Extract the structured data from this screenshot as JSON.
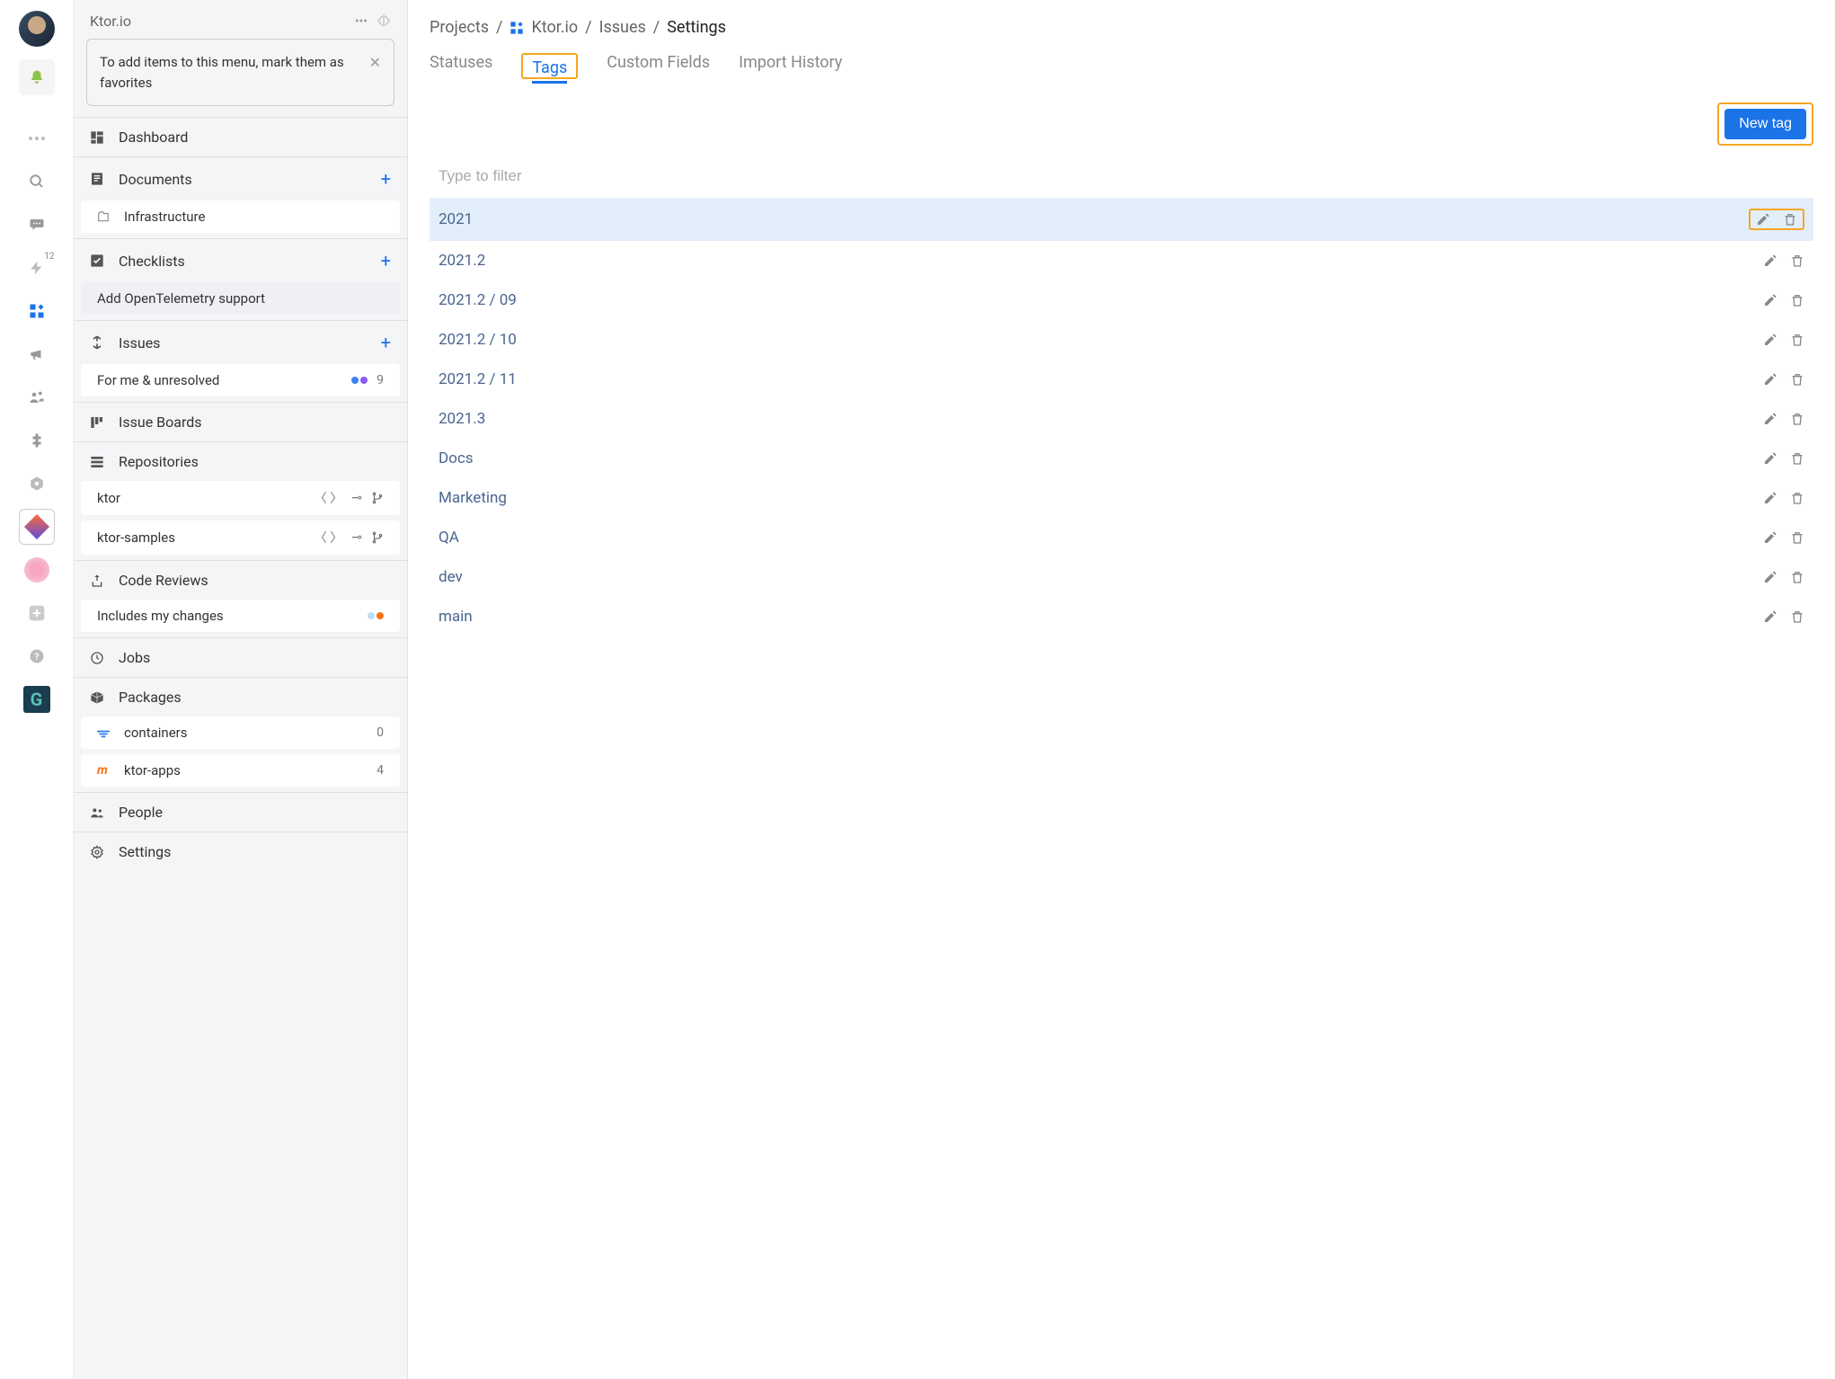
{
  "navRail": {
    "notificationsBadge": "12"
  },
  "sidebar": {
    "title": "Ktor.io",
    "favHint": "To add items to this menu, mark them as favorites",
    "sections": {
      "dashboard": {
        "label": "Dashboard"
      },
      "documents": {
        "label": "Documents",
        "items": [
          {
            "label": "Infrastructure"
          }
        ]
      },
      "checklists": {
        "label": "Checklists",
        "items": [
          {
            "label": "Add OpenTelemetry support"
          }
        ]
      },
      "issues": {
        "label": "Issues",
        "items": [
          {
            "label": "For me & unresolved",
            "count": "9"
          }
        ]
      },
      "issueBoards": {
        "label": "Issue Boards"
      },
      "repositories": {
        "label": "Repositories",
        "items": [
          {
            "label": "ktor"
          },
          {
            "label": "ktor-samples"
          }
        ]
      },
      "codeReviews": {
        "label": "Code Reviews",
        "items": [
          {
            "label": "Includes my changes"
          }
        ]
      },
      "jobs": {
        "label": "Jobs"
      },
      "packages": {
        "label": "Packages",
        "items": [
          {
            "label": "containers",
            "count": "0"
          },
          {
            "label": "ktor-apps",
            "count": "4"
          }
        ]
      },
      "people": {
        "label": "People"
      },
      "settings": {
        "label": "Settings"
      }
    }
  },
  "main": {
    "breadcrumb": {
      "projects": "Projects",
      "project": "Ktor.io",
      "issues": "Issues",
      "current": "Settings"
    },
    "tabs": {
      "statuses": "Statuses",
      "tags": "Tags",
      "customFields": "Custom Fields",
      "importHistory": "Import History"
    },
    "newTagLabel": "New tag",
    "filterPlaceholder": "Type to filter",
    "tags": [
      "2021",
      "2021.2",
      "2021.2 / 09",
      "2021.2 / 10",
      "2021.2 / 11",
      "2021.3",
      "Docs",
      "Marketing",
      "QA",
      "dev",
      "main"
    ]
  }
}
